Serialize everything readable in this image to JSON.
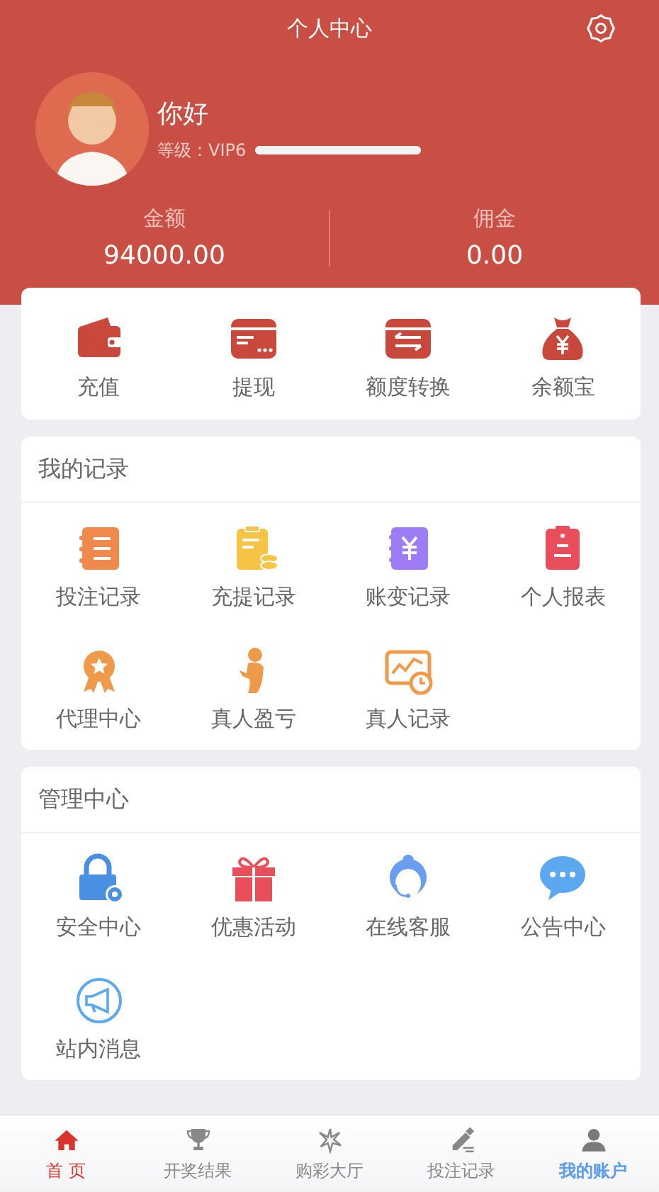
{
  "header": {
    "title": "个人中心"
  },
  "profile": {
    "greeting": "你好",
    "level_label": "等级：VIP6",
    "level": 1
  },
  "balances": [
    {
      "label": "金额",
      "value": "94000.00"
    },
    {
      "label": "佣金",
      "value": "0.00"
    }
  ],
  "quick_actions": [
    {
      "label": "充值",
      "kind": "wallet"
    },
    {
      "label": "提现",
      "kind": "card"
    },
    {
      "label": "额度转换",
      "kind": "transfer"
    },
    {
      "label": "余额宝",
      "kind": "moneybag"
    }
  ],
  "sections": [
    {
      "title": "我的记录",
      "items": [
        {
          "label": "投注记录",
          "kind": "notebook"
        },
        {
          "label": "充提记录",
          "kind": "clipboard-coins"
        },
        {
          "label": "账变记录",
          "kind": "yen-book"
        },
        {
          "label": "个人报表",
          "kind": "clipboard"
        },
        {
          "label": "代理中心",
          "kind": "medal"
        },
        {
          "label": "真人盈亏",
          "kind": "figure"
        },
        {
          "label": "真人记录",
          "kind": "chart-clock"
        }
      ]
    },
    {
      "title": "管理中心",
      "items": [
        {
          "label": "安全中心",
          "kind": "lock"
        },
        {
          "label": "优惠活动",
          "kind": "gift"
        },
        {
          "label": "在线客服",
          "kind": "agent"
        },
        {
          "label": "公告中心",
          "kind": "chat"
        },
        {
          "label": "站内消息",
          "kind": "megaphone"
        }
      ]
    }
  ],
  "tab_bar": [
    {
      "label": "首 页",
      "kind": "home",
      "selected": false,
      "color": "#d9342b"
    },
    {
      "label": "开奖结果",
      "kind": "trophy",
      "selected": false,
      "color": "#888888"
    },
    {
      "label": "购彩大厅",
      "kind": "burst",
      "selected": false,
      "color": "#888888"
    },
    {
      "label": "投注记录",
      "kind": "pencil",
      "selected": false,
      "color": "#888888"
    },
    {
      "label": "我的账户",
      "kind": "person",
      "selected": true,
      "color": "#5a9cf0"
    }
  ]
}
